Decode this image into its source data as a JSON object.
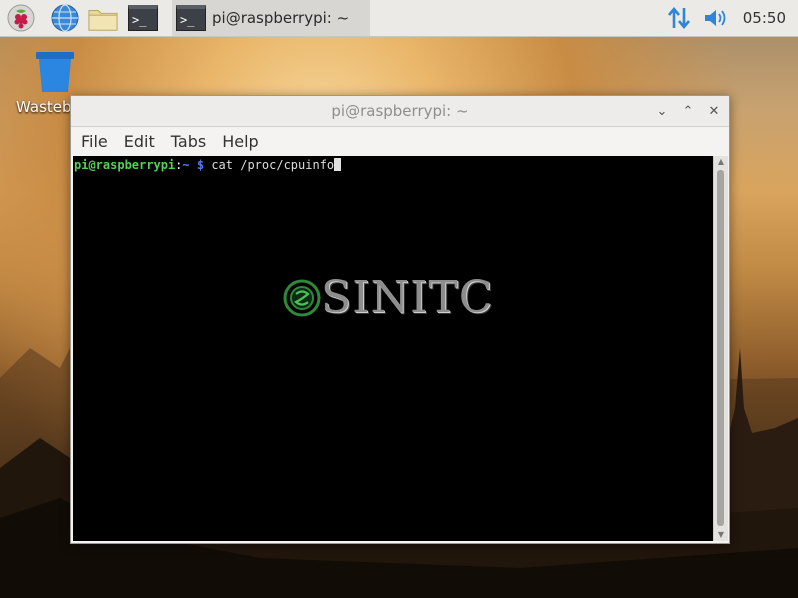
{
  "taskbar": {
    "active_task_label": "pi@raspberrypi: ~",
    "clock": "05:50",
    "icons": [
      "raspberry-menu-icon",
      "browser-globe-icon",
      "file-manager-icon",
      "terminal-launcher-icon",
      "network-arrows-icon",
      "volume-icon"
    ]
  },
  "desktop": {
    "trash_label": "Wasteb"
  },
  "window": {
    "title": "pi@raspberrypi: ~",
    "menus": [
      "File",
      "Edit",
      "Tabs",
      "Help"
    ],
    "terminal": {
      "prompt_user": "pi@raspberrypi",
      "prompt_sep": ":",
      "prompt_dir": "~",
      "prompt_symbol": "$",
      "command": "cat /proc/cpuinfo"
    }
  },
  "watermark": {
    "text": "SINITC"
  },
  "colors": {
    "prompt_user": "#52d154",
    "prompt_dir": "#5b7bf5",
    "terminal_bg": "#000000",
    "accent_blue": "#3a88d6"
  }
}
